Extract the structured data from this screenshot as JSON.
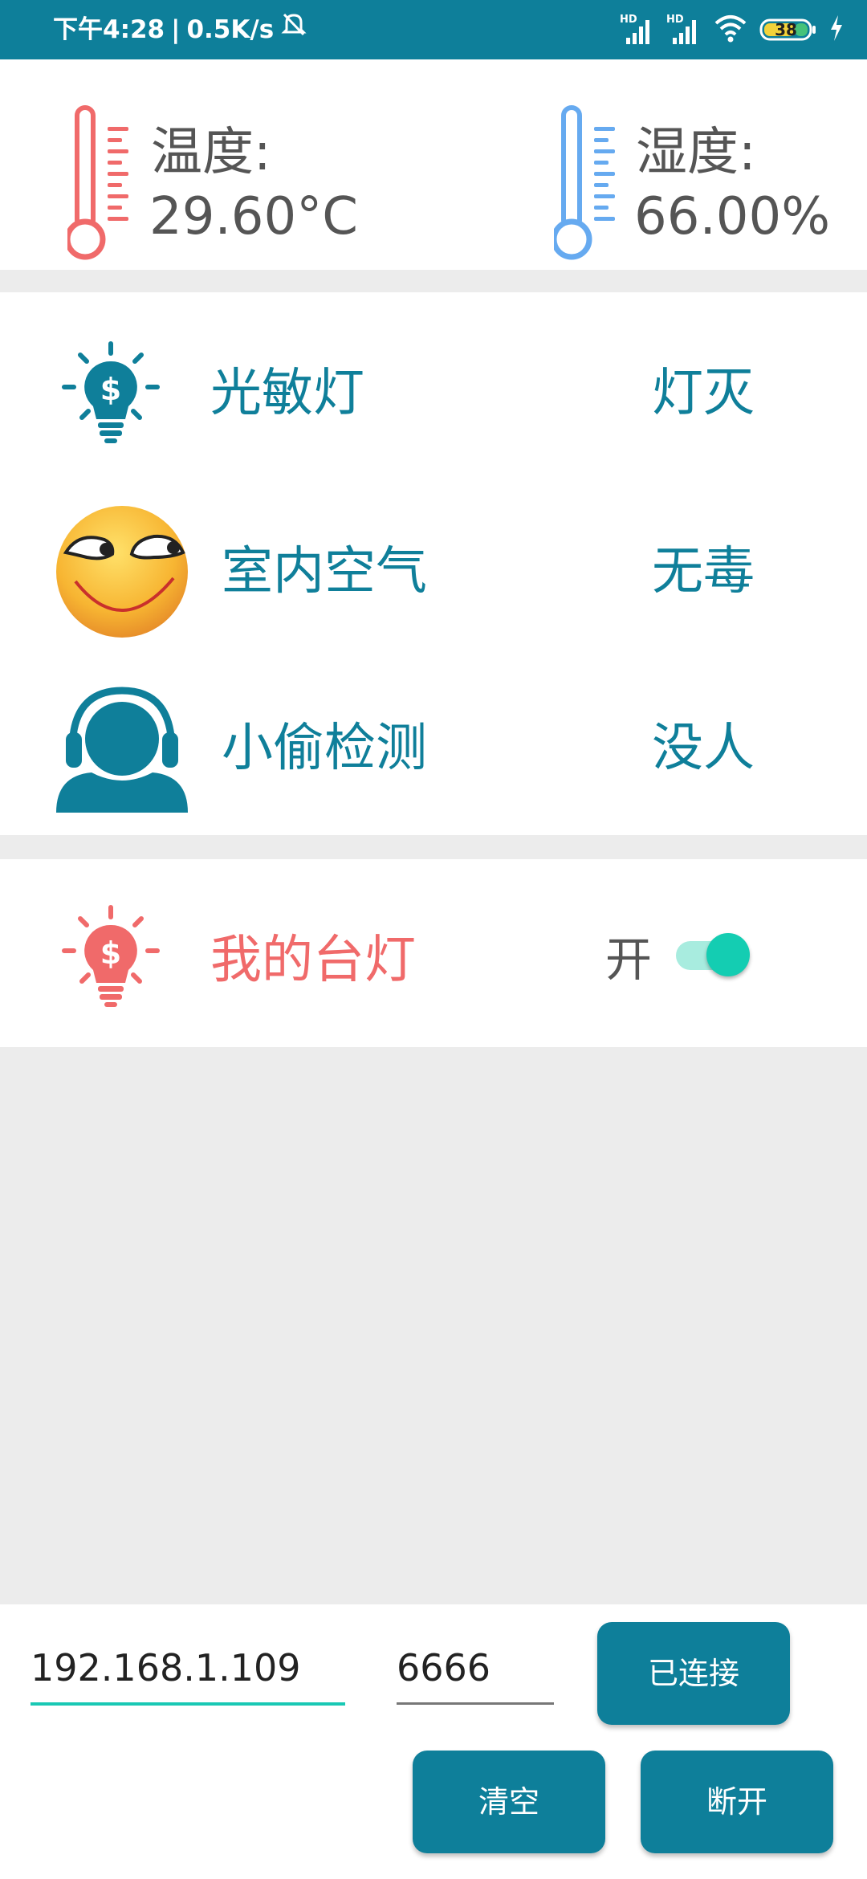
{
  "status_bar": {
    "time": "下午4:28",
    "separator": "|",
    "net_speed": "0.5K/s",
    "signal_1_label": "HD",
    "signal_2_label": "HD",
    "battery": "38"
  },
  "sensors": {
    "temperature": {
      "label": "温度:",
      "value": "29.60°C",
      "icon_color": "#f06a6a"
    },
    "humidity": {
      "label": "湿度:",
      "value": "66.00%",
      "icon_color": "#66aaf0"
    }
  },
  "rows": [
    {
      "label": "光敏灯",
      "status": "灯灭"
    },
    {
      "label": "室内空气",
      "status": "无毒"
    },
    {
      "label": "小偷检测",
      "status": "没人"
    }
  ],
  "lamp": {
    "label": "我的台灯",
    "toggle_label": "开",
    "toggle_on": true
  },
  "connection": {
    "ip": "192.168.1.109",
    "port": "6666",
    "connect_button": "已连接",
    "clear_button": "清空",
    "disconnect_button": "断开"
  },
  "colors": {
    "primary": "#0e7f9a",
    "accent": "#14cdb2",
    "red": "#f06a6a",
    "blue": "#66aaf0"
  }
}
